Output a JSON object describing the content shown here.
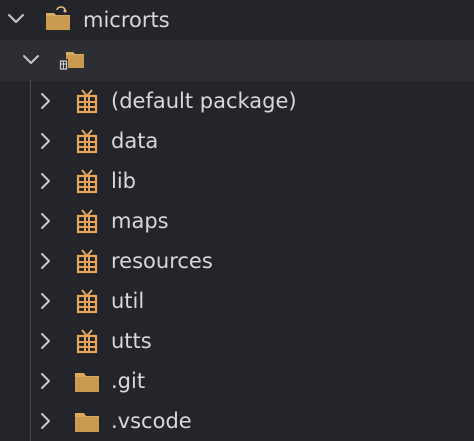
{
  "explorer": {
    "root": {
      "label": "microrts",
      "expanded": true,
      "icon": "folder-git-icon"
    },
    "source_folder": {
      "label": "",
      "expanded": true,
      "icon": "source-folder-icon"
    },
    "items": [
      {
        "label": "(default package)",
        "type": "package",
        "icon": "package-icon"
      },
      {
        "label": "data",
        "type": "package",
        "icon": "package-icon"
      },
      {
        "label": "lib",
        "type": "package",
        "icon": "package-icon"
      },
      {
        "label": "maps",
        "type": "package",
        "icon": "package-icon"
      },
      {
        "label": "resources",
        "type": "package",
        "icon": "package-icon"
      },
      {
        "label": "util",
        "type": "package",
        "icon": "package-icon"
      },
      {
        "label": "utts",
        "type": "package",
        "icon": "package-icon"
      },
      {
        "label": ".git",
        "type": "folder",
        "icon": "folder-icon"
      },
      {
        "label": ".vscode",
        "type": "folder",
        "icon": "folder-icon"
      }
    ]
  },
  "colors": {
    "background": "#24252a",
    "selected_row": "#2c2e34",
    "folder": "#d7ab62",
    "package": "#e5a45a",
    "text": "#d8d8d8",
    "chevron": "#c8c8c8"
  }
}
